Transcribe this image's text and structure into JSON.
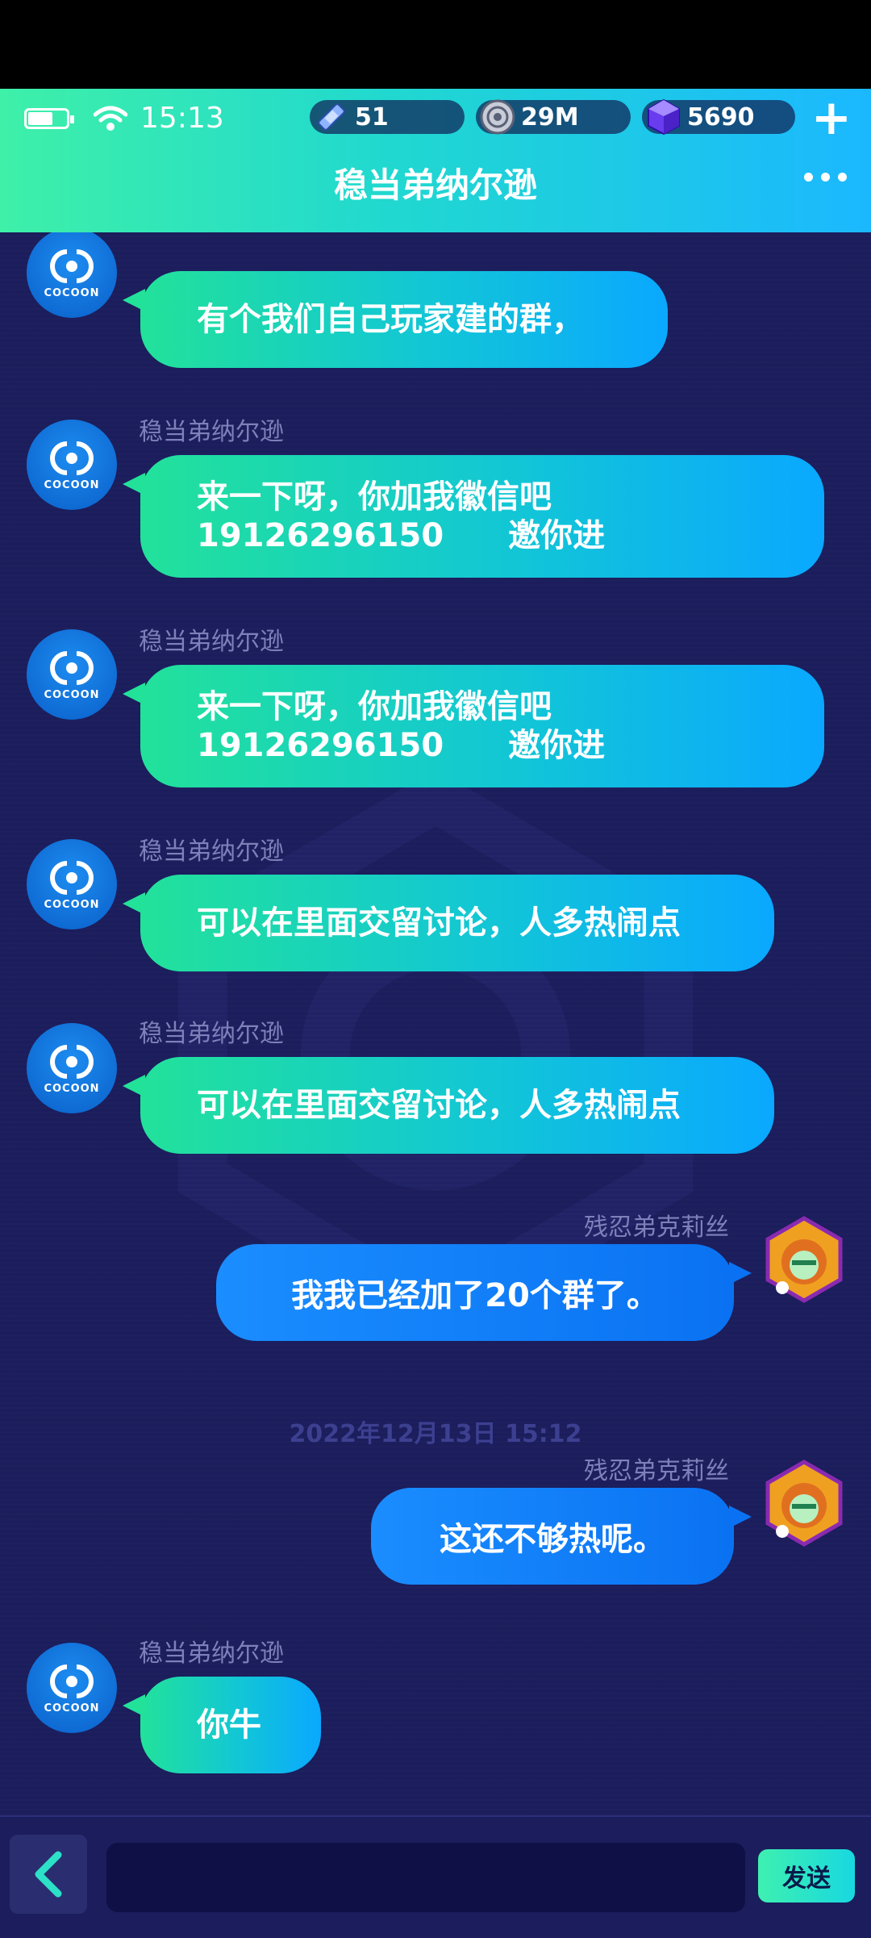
{
  "status_bar": {
    "time": "15:13",
    "battery_icon": "battery-icon",
    "wifi_icon": "wifi-icon"
  },
  "resources": [
    {
      "icon": "ticket-icon",
      "value": "51"
    },
    {
      "icon": "coin-icon",
      "value": "29M"
    },
    {
      "icon": "gem-icon",
      "value": "5690"
    }
  ],
  "header": {
    "title": "稳当弟纳尔逊"
  },
  "messages": [
    {
      "side": "left",
      "sender": "",
      "lines": [
        "有个我们自己玩家建的群，"
      ]
    },
    {
      "side": "left",
      "sender": "稳当弟纳尔逊",
      "lines": [
        "来一下呀，你加我徽信吧",
        "19126296150　　邀你进"
      ]
    },
    {
      "side": "left",
      "sender": "稳当弟纳尔逊",
      "lines": [
        "来一下呀，你加我徽信吧",
        "19126296150　　邀你进"
      ]
    },
    {
      "side": "left",
      "sender": "稳当弟纳尔逊",
      "lines": [
        "可以在里面交留讨论，人多热闹点"
      ]
    },
    {
      "side": "left",
      "sender": "稳当弟纳尔逊",
      "lines": [
        "可以在里面交留讨论，人多热闹点"
      ]
    },
    {
      "side": "right",
      "sender": "残忍弟克莉丝",
      "lines": [
        "我我已经加了20个群了。"
      ]
    },
    {
      "side": "right",
      "sender": "残忍弟克莉丝",
      "lines": [
        "这还不够热呢。"
      ]
    },
    {
      "side": "left",
      "sender": "稳当弟纳尔逊",
      "lines": [
        "你牛"
      ]
    }
  ],
  "timestamp": "2022年12月13日 15:12",
  "avatar_left_text": "COCOON",
  "footer": {
    "send_label": "发送",
    "input_value": ""
  },
  "colors": {
    "accent_green": "#22e29a",
    "accent_blue": "#0a72f2",
    "background": "#1b1d5c"
  }
}
